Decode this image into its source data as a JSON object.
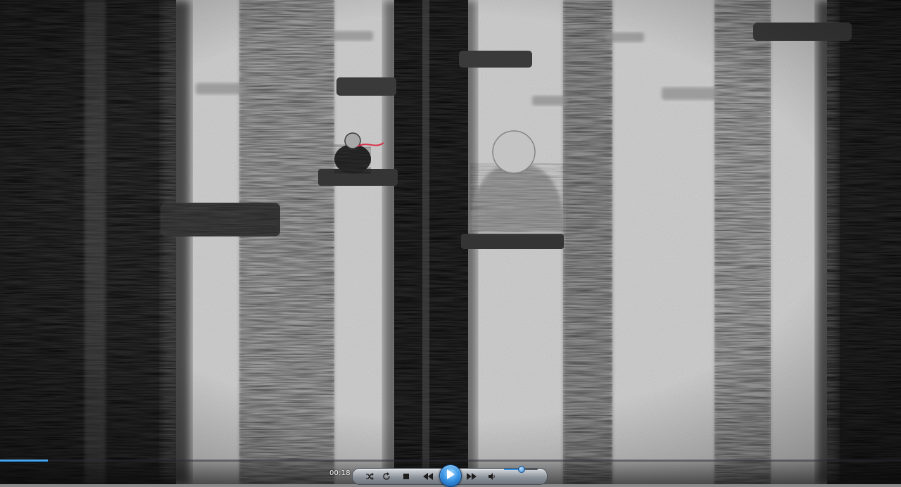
{
  "player": {
    "elapsed_time": "00:18",
    "progress_fraction": 0.053,
    "volume_fraction": 0.5,
    "accent_color": "#2e8fe6",
    "buttons": {
      "shuffle": "shuffle-icon",
      "repeat": "repeat-icon",
      "stop": "stop-icon",
      "previous": "rewind-icon",
      "play": "play-icon",
      "next": "fast-forward-icon",
      "mute": "speaker-icon"
    }
  },
  "frame": {
    "description_colors": {
      "paper": "#d2d2d2",
      "charcoal": "#1c1c1c",
      "scarf": "#d8324a"
    }
  }
}
